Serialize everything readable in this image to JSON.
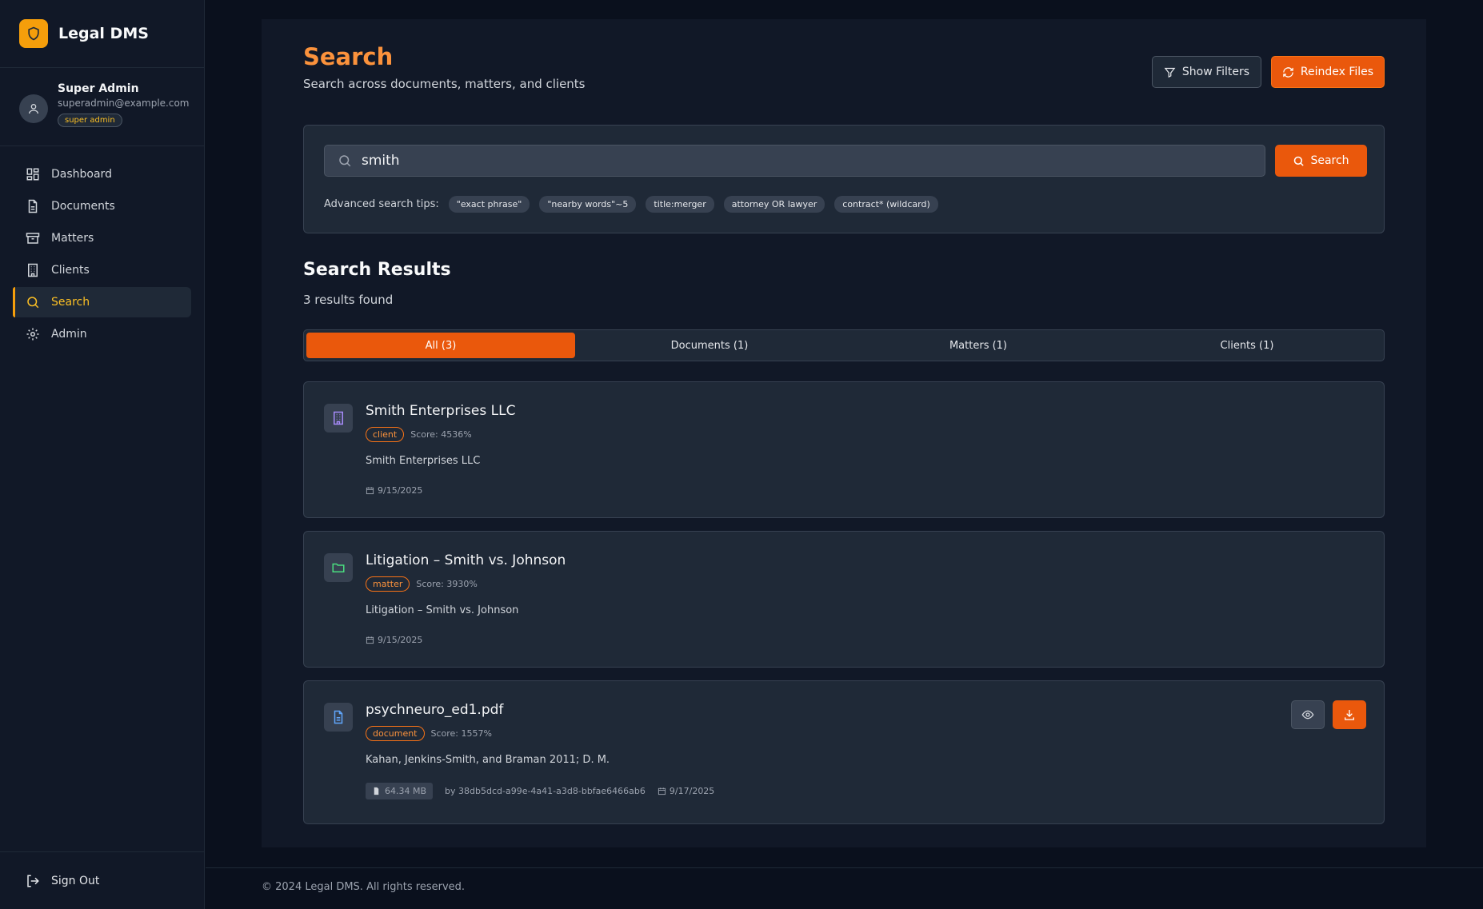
{
  "app": {
    "name": "Legal DMS"
  },
  "user": {
    "name": "Super Admin",
    "email": "superadmin@example.com",
    "role": "super admin"
  },
  "nav": {
    "items": [
      {
        "label": "Dashboard",
        "icon": "dashboard-icon"
      },
      {
        "label": "Documents",
        "icon": "document-icon"
      },
      {
        "label": "Matters",
        "icon": "archive-icon"
      },
      {
        "label": "Clients",
        "icon": "building-icon"
      },
      {
        "label": "Search",
        "icon": "search-icon",
        "active": true
      },
      {
        "label": "Admin",
        "icon": "gear-icon"
      }
    ],
    "sign_out": "Sign Out"
  },
  "page": {
    "title": "Search",
    "subtitle": "Search across documents, matters, and clients"
  },
  "toolbar": {
    "show_filters": "Show Filters",
    "reindex": "Reindex Files"
  },
  "search": {
    "value": "smith",
    "button": "Search",
    "tips_label": "Advanced search tips:",
    "tips": [
      "\"exact phrase\"",
      "\"nearby words\"~5",
      "title:merger",
      "attorney OR lawyer",
      "contract* (wildcard)"
    ]
  },
  "results": {
    "title": "Search Results",
    "count": "3 results found",
    "tabs": [
      {
        "label": "All (3)",
        "active": true
      },
      {
        "label": "Documents (1)"
      },
      {
        "label": "Matters (1)"
      },
      {
        "label": "Clients (1)"
      }
    ],
    "items": [
      {
        "title": "Smith Enterprises LLC",
        "type": "client",
        "score": "Score: 4536%",
        "snippet": "Smith Enterprises LLC",
        "date": "9/15/2025",
        "icon": "building-icon"
      },
      {
        "title": "Litigation – Smith vs. Johnson",
        "type": "matter",
        "score": "Score: 3930%",
        "snippet": "Litigation – Smith vs. Johnson",
        "date": "9/15/2025",
        "icon": "folder-icon"
      },
      {
        "title": "psychneuro_ed1.pdf",
        "type": "document",
        "score": "Score: 1557%",
        "snippet": "Kahan, Jenkins-Smith, and Braman 2011; D. M.",
        "size": "64.34 MB",
        "author": "by 38db5dcd-a99e-4a41-a3d8-bbfae6466ab6",
        "date": "9/17/2025",
        "icon": "file-icon"
      }
    ]
  },
  "footer": {
    "text": "© 2024 Legal DMS. All rights reserved."
  },
  "colors": {
    "accent": "#ea580c",
    "title_orange": "#fb923c",
    "active_nav": "#fbbf24",
    "background": "#0a101d",
    "panel": "#111827"
  }
}
